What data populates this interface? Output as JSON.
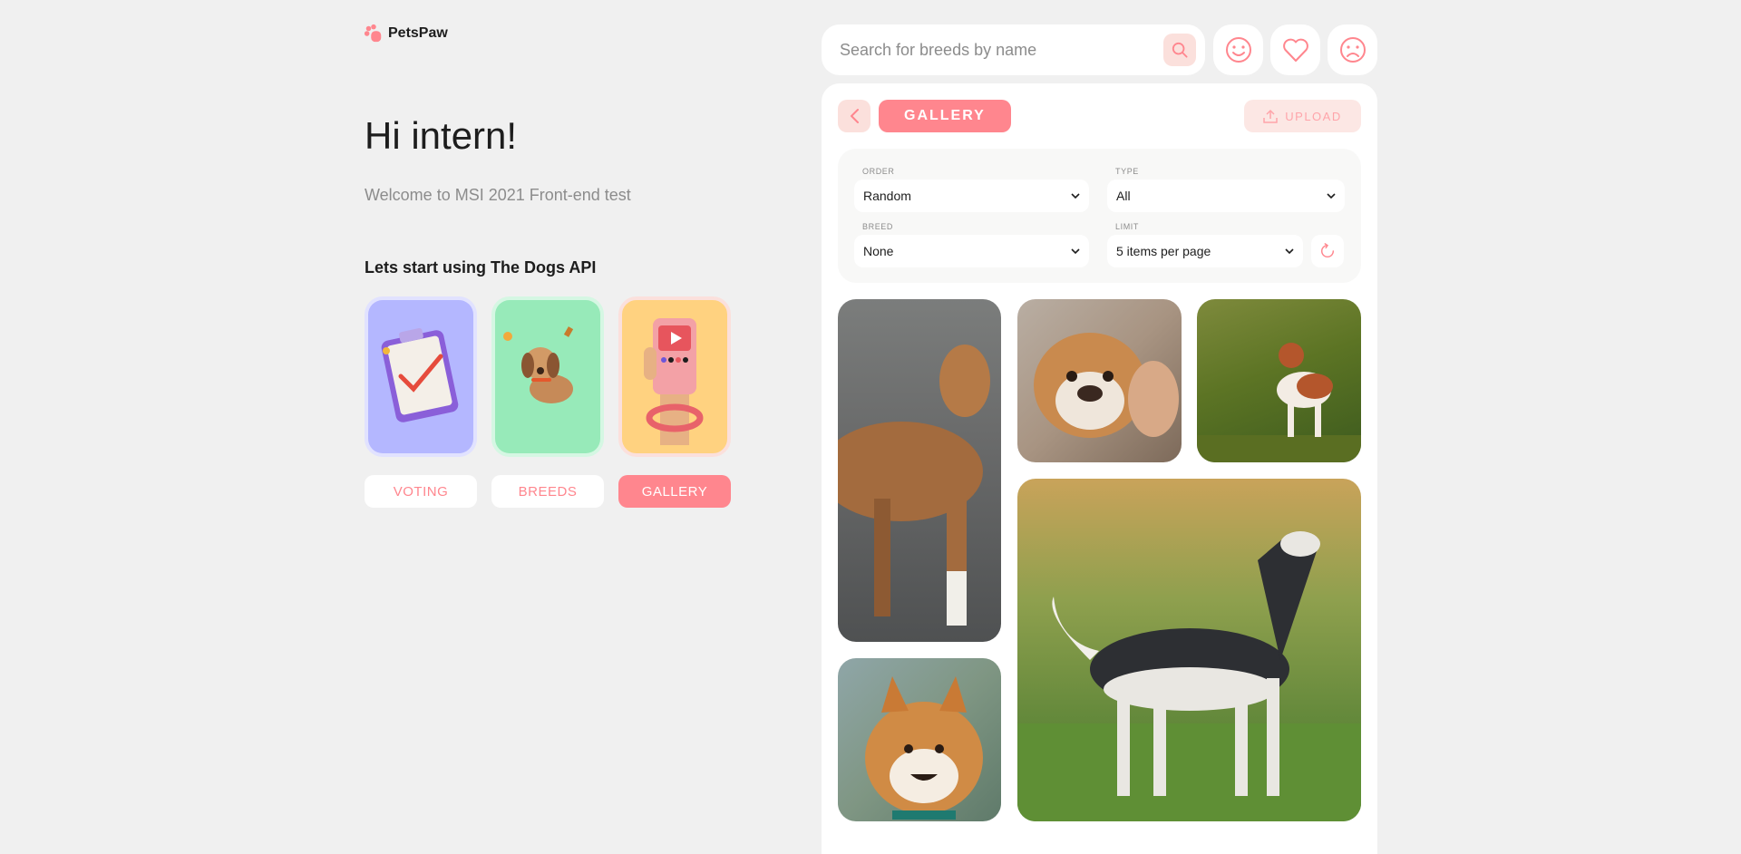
{
  "brand": {
    "name": "PetsPaw",
    "accent": "#ff868e",
    "accent_light": "#fbe0dc"
  },
  "intro": {
    "greeting": "Hi intern!",
    "welcome": "Welcome to MSI 2021 Front-end test",
    "start_title": "Lets start using The Dogs API"
  },
  "nav": {
    "items": [
      {
        "label": "VOTING",
        "active": false
      },
      {
        "label": "BREEDS",
        "active": false
      },
      {
        "label": "GALLERY",
        "active": true
      }
    ]
  },
  "search": {
    "placeholder": "Search for breeds by name"
  },
  "header_icons": [
    "smile-icon",
    "heart-icon",
    "sad-icon"
  ],
  "gallery": {
    "title": "GALLERY",
    "upload_label": "UPLOAD",
    "filters": {
      "order": {
        "label": "ORDER",
        "value": "Random"
      },
      "type": {
        "label": "TYPE",
        "value": "All"
      },
      "breed": {
        "label": "BREED",
        "value": "None"
      },
      "limit": {
        "label": "LIMIT",
        "value": "5 items per page"
      }
    }
  }
}
